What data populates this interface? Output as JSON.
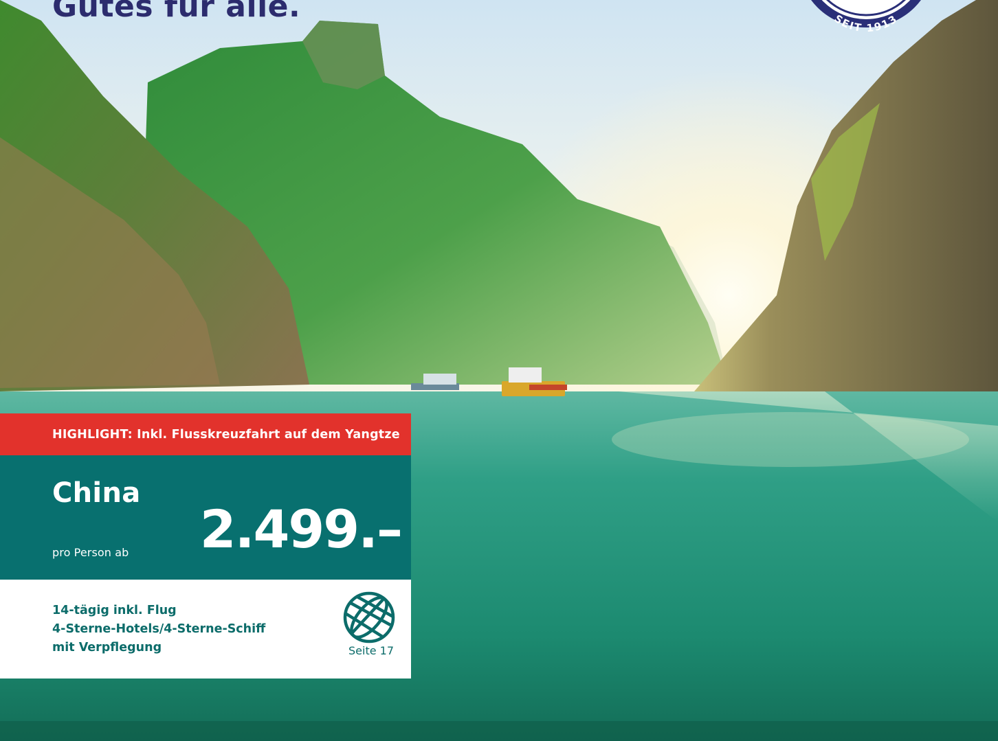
{
  "headline": "Gutes für alle.",
  "seal": {
    "text": "SEIT 1913"
  },
  "offer": {
    "highlight": "HIGHLIGHT: Inkl. Flusskreuzfahrt auf dem Yangtze",
    "destination": "China",
    "per_person": "pro Person ab",
    "price": "2.499.–",
    "details": [
      "14-tägig inkl. Flug",
      "4-Sterne-Hotels/4-Sterne-Schiff",
      "mit Verpflegung"
    ],
    "page_ref": "Seite 17"
  },
  "colors": {
    "highlight_red": "#e2322c",
    "card_teal": "#08706f",
    "details_text": "#0c6c6a",
    "headline_navy": "#2c2c6e",
    "seal_navy": "#2a2f78"
  },
  "icons": [
    "globe-icon"
  ]
}
